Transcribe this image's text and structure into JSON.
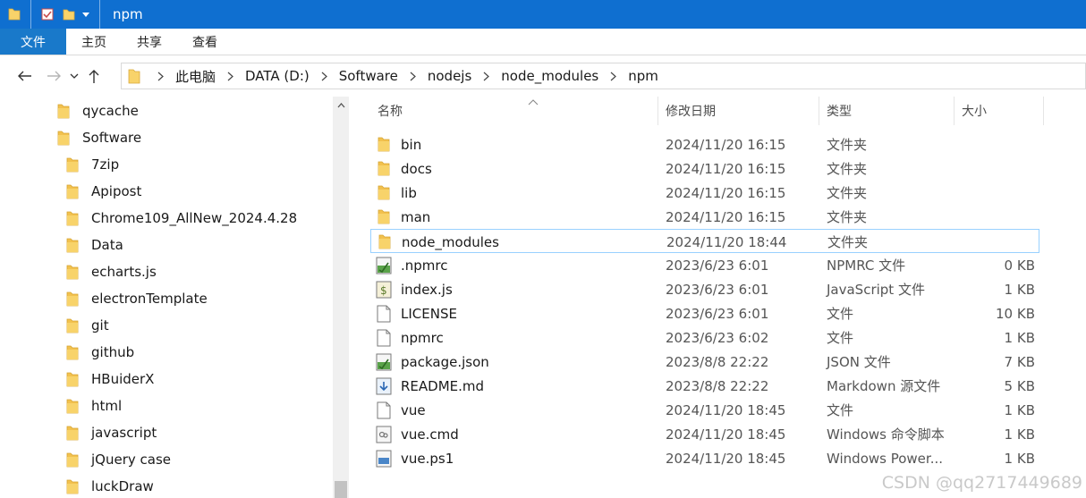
{
  "window": {
    "title": "npm",
    "accent": "#0f6fd0"
  },
  "ribbon": {
    "tabs": [
      "文件",
      "主页",
      "共享",
      "查看"
    ]
  },
  "address": {
    "crumbs": [
      "此电脑",
      "DATA (D:)",
      "Software",
      "nodejs",
      "node_modules",
      "npm"
    ]
  },
  "nav": {
    "icons": [
      "back-arrow-icon",
      "forward-arrow-icon",
      "recent-dropdown-icon",
      "up-arrow-icon"
    ]
  },
  "tree": {
    "items": [
      {
        "label": "qycache",
        "level": 0
      },
      {
        "label": "Software",
        "level": 0
      },
      {
        "label": "7zip",
        "level": 1
      },
      {
        "label": "Apipost",
        "level": 1
      },
      {
        "label": "Chrome109_AllNew_2024.4.28",
        "level": 1
      },
      {
        "label": "Data",
        "level": 1
      },
      {
        "label": "echarts.js",
        "level": 1
      },
      {
        "label": "electronTemplate",
        "level": 1
      },
      {
        "label": "git",
        "level": 1
      },
      {
        "label": "github",
        "level": 1
      },
      {
        "label": "HBuiderX",
        "level": 1
      },
      {
        "label": "html",
        "level": 1
      },
      {
        "label": "javascript",
        "level": 1
      },
      {
        "label": "jQuery case",
        "level": 1
      },
      {
        "label": "luckDraw",
        "level": 1
      }
    ]
  },
  "columns": {
    "name": "名称",
    "date": "修改日期",
    "type": "类型",
    "size": "大小"
  },
  "files": [
    {
      "name": "bin",
      "date": "2024/11/20 16:15",
      "type": "文件夹",
      "size": "",
      "icon": "folder-icon"
    },
    {
      "name": "docs",
      "date": "2024/11/20 16:15",
      "type": "文件夹",
      "size": "",
      "icon": "folder-icon"
    },
    {
      "name": "lib",
      "date": "2024/11/20 16:15",
      "type": "文件夹",
      "size": "",
      "icon": "folder-icon"
    },
    {
      "name": "man",
      "date": "2024/11/20 16:15",
      "type": "文件夹",
      "size": "",
      "icon": "folder-icon"
    },
    {
      "name": "node_modules",
      "date": "2024/11/20 18:44",
      "type": "文件夹",
      "size": "",
      "icon": "folder-icon",
      "selected": true
    },
    {
      "name": ".npmrc",
      "date": "2023/6/23 6:01",
      "type": "NPMRC 文件",
      "size": "0 KB",
      "icon": "config-file-icon"
    },
    {
      "name": "index.js",
      "date": "2023/6/23 6:01",
      "type": "JavaScript 文件",
      "size": "1 KB",
      "icon": "script-file-icon"
    },
    {
      "name": "LICENSE",
      "date": "2023/6/23 6:01",
      "type": "文件",
      "size": "10 KB",
      "icon": "blank-file-icon"
    },
    {
      "name": "npmrc",
      "date": "2023/6/23 6:02",
      "type": "文件",
      "size": "1 KB",
      "icon": "blank-file-icon"
    },
    {
      "name": "package.json",
      "date": "2023/8/8 22:22",
      "type": "JSON 文件",
      "size": "7 KB",
      "icon": "config-file-icon"
    },
    {
      "name": "README.md",
      "date": "2023/8/8 22:22",
      "type": "Markdown 源文件",
      "size": "5 KB",
      "icon": "markdown-file-icon"
    },
    {
      "name": "vue",
      "date": "2024/11/20 18:45",
      "type": "文件",
      "size": "1 KB",
      "icon": "blank-file-icon"
    },
    {
      "name": "vue.cmd",
      "date": "2024/11/20 18:45",
      "type": "Windows 命令脚本",
      "size": "1 KB",
      "icon": "cmd-file-icon"
    },
    {
      "name": "vue.ps1",
      "date": "2024/11/20 18:45",
      "type": "Windows Power...",
      "size": "1 KB",
      "icon": "powershell-file-icon"
    }
  ],
  "watermark": "CSDN @qq2717449689",
  "colors": {
    "folder": "#f2c14e",
    "ribbonFile": "#1979ca",
    "selectionBorder": "#99d1ff"
  }
}
